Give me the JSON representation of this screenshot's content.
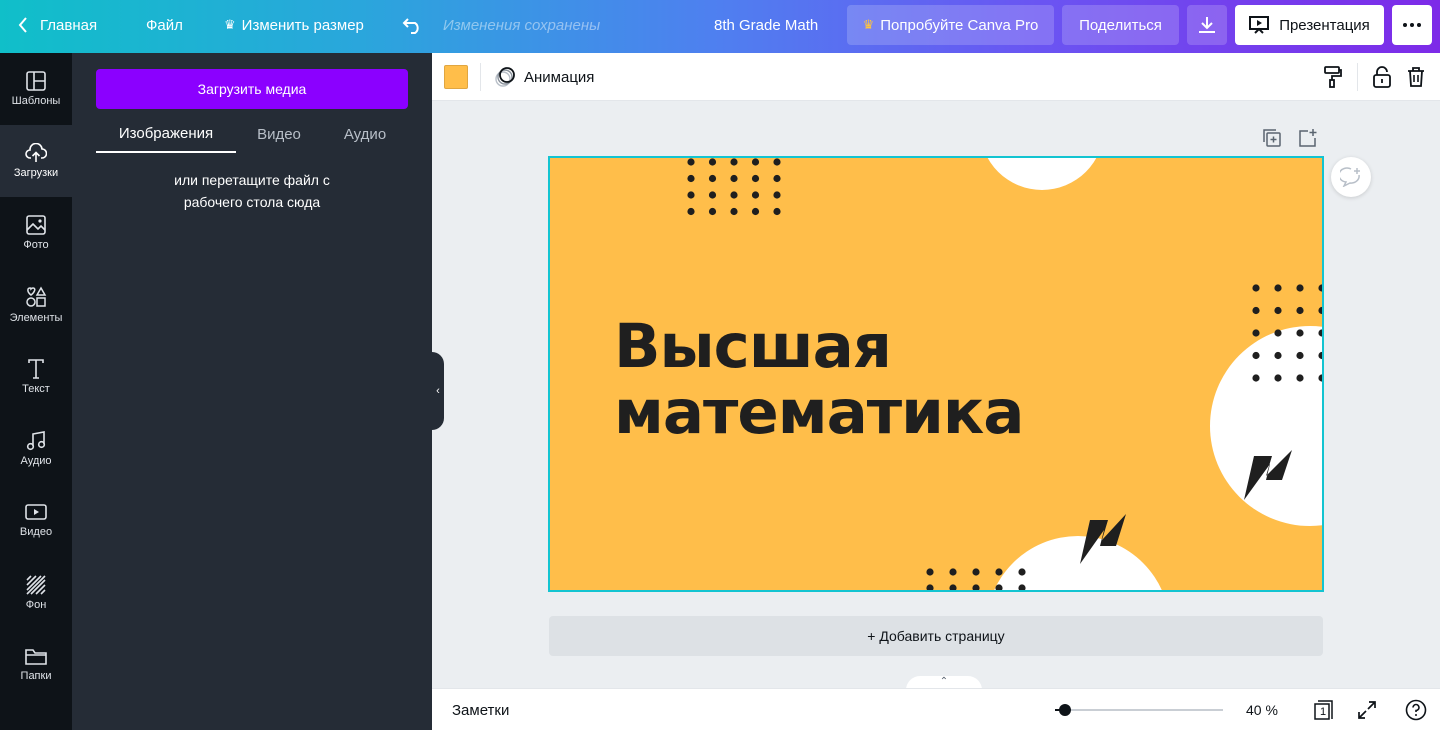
{
  "topbar": {
    "home": "Главная",
    "file": "Файл",
    "resize": "Изменить размер",
    "saved_status": "Изменения сохранены",
    "design_title": "8th Grade Math",
    "try_pro": "Попробуйте Canva Pro",
    "share": "Поделиться",
    "present": "Презентация"
  },
  "rail": {
    "items": [
      {
        "label": "Шаблоны",
        "icon": "templates-icon"
      },
      {
        "label": "Загрузки",
        "icon": "upload-cloud-icon"
      },
      {
        "label": "Фото",
        "icon": "photo-icon"
      },
      {
        "label": "Элементы",
        "icon": "elements-icon"
      },
      {
        "label": "Текст",
        "icon": "text-icon"
      },
      {
        "label": "Аудио",
        "icon": "music-icon"
      },
      {
        "label": "Видео",
        "icon": "video-icon"
      },
      {
        "label": "Фон",
        "icon": "background-icon"
      },
      {
        "label": "Папки",
        "icon": "folder-icon"
      }
    ],
    "active_index": 1
  },
  "uploads": {
    "upload_button": "Загрузить медиа",
    "tabs": [
      "Изображения",
      "Видео",
      "Аудио"
    ],
    "active_tab": 0,
    "drop_hint_line1": "или перетащите файл с",
    "drop_hint_line2": "рабочего стола сюда"
  },
  "canvas_toolbar": {
    "background_color": "#ffbe4a",
    "animation": "Анимация"
  },
  "slide": {
    "title_line1": "Высшая",
    "title_line2": "математика",
    "background": "#ffbe4a",
    "selection_color": "#13c4d1"
  },
  "add_page": "+ Добавить страницу",
  "bottombar": {
    "notes": "Заметки",
    "zoom_percent": 40,
    "zoom_label": "40 %",
    "page_count": "1"
  },
  "colors": {
    "accent_purple": "#8b00ff",
    "rail_bg": "#0e1318",
    "panel_bg": "#252c36",
    "pro_crown": "#ffc53d"
  }
}
